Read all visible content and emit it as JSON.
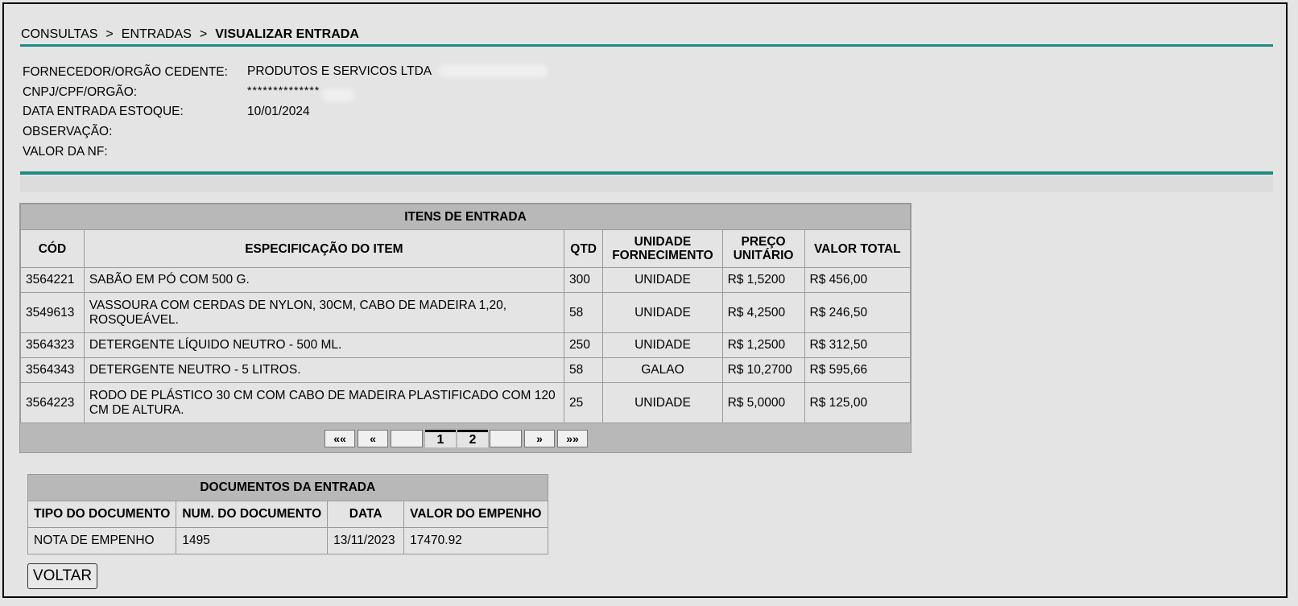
{
  "breadcrumb": {
    "items": [
      "CONSULTAS",
      "ENTRADAS"
    ],
    "separator": ">",
    "current": "VISUALIZAR ENTRADA"
  },
  "info": {
    "fornecedor_label": "FORNECEDOR/ORGÃO CEDENTE:",
    "fornecedor_value": "PRODUTOS E SERVICOS LTDA",
    "cnpj_label": "CNPJ/CPF/ORGÃO:",
    "cnpj_value": "**************",
    "data_label": "DATA ENTRADA ESTOQUE:",
    "data_value": "10/01/2024",
    "obs_label": "OBSERVAÇÃO:",
    "obs_value": "",
    "valor_label": "VALOR DA NF:",
    "valor_value": ""
  },
  "items_table": {
    "title": "ITENS DE ENTRADA",
    "headers": {
      "cod": "CÓD",
      "spec": "ESPECIFICAÇÃO DO ITEM",
      "qtd": "QTD",
      "unidade_1": "UNIDADE",
      "unidade_2": "FORNECIMENTO",
      "preco_1": "PREÇO",
      "preco_2": "UNITÁRIO",
      "total": "VALOR TOTAL"
    },
    "rows": [
      {
        "cod": "3564221",
        "spec": "SABÃO EM PÓ COM 500 G.",
        "qtd": "300",
        "unidade": "UNIDADE",
        "preco": "R$ 1,5200",
        "total": "R$ 456,00"
      },
      {
        "cod": "3549613",
        "spec": "VASSOURA COM CERDAS DE NYLON, 30CM, CABO DE MADEIRA 1,20, ROSQUEÁVEL.",
        "qtd": "58",
        "unidade": "UNIDADE",
        "preco": "R$ 4,2500",
        "total": "R$ 246,50"
      },
      {
        "cod": "3564323",
        "spec": "DETERGENTE LÍQUIDO NEUTRO - 500 ML.",
        "qtd": "250",
        "unidade": "UNIDADE",
        "preco": "R$ 1,2500",
        "total": "R$ 312,50"
      },
      {
        "cod": "3564343",
        "spec": "DETERGENTE NEUTRO - 5 LITROS.",
        "qtd": "58",
        "unidade": "GALAO",
        "preco": "R$ 10,2700",
        "total": "R$ 595,66"
      },
      {
        "cod": "3564223",
        "spec": "RODO DE PLÁSTICO 30 CM COM CABO DE MADEIRA PLASTIFICADO COM 120 CM DE ALTURA.",
        "qtd": "25",
        "unidade": "UNIDADE",
        "preco": "R$ 5,0000",
        "total": "R$ 125,00"
      }
    ],
    "pager": {
      "first": "««",
      "prev": "«",
      "pages": [
        "1",
        "2"
      ],
      "next": "»",
      "last": "»»"
    }
  },
  "docs_table": {
    "title": "DOCUMENTOS DA ENTRADA",
    "headers": {
      "tipo": "TIPO DO DOCUMENTO",
      "num": "NUM. DO DOCUMENTO",
      "data": "DATA",
      "valor": "VALOR DO EMPENHO"
    },
    "rows": [
      {
        "tipo": "NOTA DE EMPENHO",
        "num": "1495",
        "data": "13/11/2023",
        "valor": "17470.92"
      }
    ]
  },
  "actions": {
    "voltar_label": "VOLTAR"
  },
  "colors": {
    "accent_rule": "#1f8a83",
    "table_header_bg": "#b8b8b8",
    "page_bg": "#e4e4e4"
  }
}
